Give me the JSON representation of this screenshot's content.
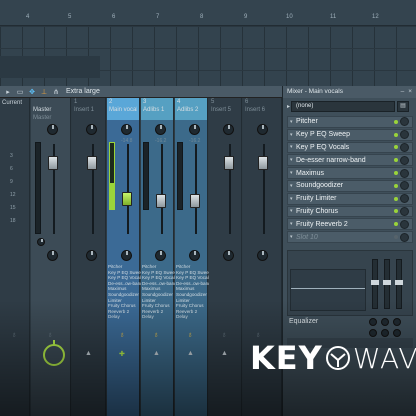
{
  "ruler": {
    "ticks": [
      "4",
      "5",
      "6",
      "7",
      "8",
      "9",
      "10",
      "11",
      "12"
    ]
  },
  "toolbar": {
    "view_mode": "Extra large"
  },
  "mixer_panel": {
    "title": "Mixer - Main vocals",
    "preset": "(none)",
    "slots": [
      {
        "label": "Pitcher",
        "empty": false
      },
      {
        "label": "Key P EQ Sweep",
        "empty": false
      },
      {
        "label": "Key P EQ Vocals",
        "empty": false
      },
      {
        "label": "De-esser narrow-band",
        "empty": false
      },
      {
        "label": "Maximus",
        "empty": false
      },
      {
        "label": "Soundgoodizer",
        "empty": false
      },
      {
        "label": "Fruity Limiter",
        "empty": false
      },
      {
        "label": "Fruity Chorus",
        "empty": false
      },
      {
        "label": "Fruity Reeverb 2",
        "empty": false
      },
      {
        "label": "Slot 10",
        "empty": true
      }
    ],
    "equalizer_label": "Equalizer"
  },
  "strips": {
    "current": {
      "name": "Current"
    },
    "master": {
      "num": "",
      "name": "Master",
      "sub": "Master"
    },
    "insert1": {
      "num": "1",
      "name": "Insert 1"
    },
    "main_vocals": {
      "num": "2",
      "name": "Main vocals",
      "db": "-14.8"
    },
    "adlibs1": {
      "num": "3",
      "name": "Adlibs 1",
      "db": "-16.2"
    },
    "adlibs2": {
      "num": "4",
      "name": "Adlibs 2",
      "db": "-16.2"
    },
    "insert5": {
      "num": "5",
      "name": "Insert 5"
    },
    "insert6": {
      "num": "6",
      "name": "Insert 6"
    }
  },
  "fx_lists": {
    "main_vocals": [
      "Pitcher",
      "Key P EQ Sweep",
      "Key P EQ Vocals",
      "De-ess..ow-band",
      "Maximus",
      "Soundgoodizer",
      "Limiter",
      "Fruity Chorus",
      "Reeverb 2",
      "Delay"
    ],
    "adlibs1": [
      "Pitcher",
      "Key P EQ Sweep",
      "Key P EQ Vocals",
      "De-ess..ow-band",
      "Maximus",
      "Soundgoodizer",
      "Limiter",
      "Fruity Chorus",
      "Reeverb 2",
      "Delay"
    ],
    "adlibs2": [
      "Pitcher",
      "Key P EQ Sweep",
      "Key P EQ Vocals",
      "De-ess..ow-band",
      "Maximus",
      "Soundgoodizer",
      "Limiter",
      "Fruity Chorus",
      "Reeverb 2",
      "Delay"
    ]
  },
  "slot_numbers": [
    "3",
    "6",
    "9",
    "12",
    "15",
    "18"
  ],
  "watermark": {
    "left": "KEY",
    "right": "WAV"
  },
  "colors": {
    "accent_blue": "#5aa7d8",
    "meter_green": "#9ad43a",
    "bulb_yellow": "#f5c542"
  }
}
